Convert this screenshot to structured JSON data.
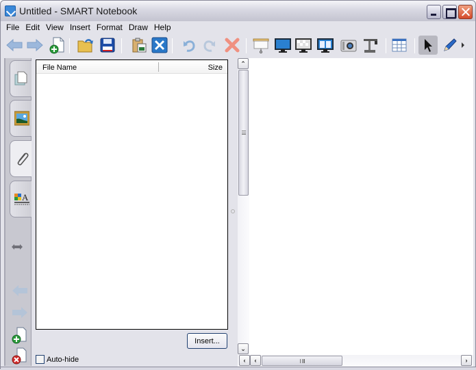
{
  "window": {
    "title": "Untitled - SMART Notebook",
    "controls": [
      "minimize",
      "maximize",
      "close"
    ]
  },
  "menu": [
    "File",
    "Edit",
    "View",
    "Insert",
    "Format",
    "Draw",
    "Help"
  ],
  "toolbar": {
    "buttons": [
      {
        "name": "back",
        "icon": "arrow-left-icon"
      },
      {
        "name": "forward",
        "icon": "arrow-right-icon"
      },
      {
        "name": "add-page",
        "icon": "add-page-icon"
      },
      {
        "name": "open",
        "icon": "open-folder-icon"
      },
      {
        "name": "save",
        "icon": "save-icon"
      },
      {
        "name": "paste",
        "icon": "paste-icon"
      },
      {
        "name": "full-screen",
        "icon": "full-screen-icon"
      },
      {
        "name": "undo",
        "icon": "undo-icon"
      },
      {
        "name": "redo",
        "icon": "redo-icon"
      },
      {
        "name": "delete",
        "icon": "delete-icon"
      },
      {
        "name": "screen-shade",
        "icon": "screen-shade-icon"
      },
      {
        "name": "full-screen-display",
        "icon": "monitor-fullscreen-icon"
      },
      {
        "name": "transparent-background",
        "icon": "monitor-transparent-icon"
      },
      {
        "name": "dual-page",
        "icon": "monitor-dual-page-icon"
      },
      {
        "name": "screen-capture",
        "icon": "camera-icon"
      },
      {
        "name": "document-camera",
        "icon": "document-camera-icon"
      },
      {
        "name": "table",
        "icon": "table-icon"
      },
      {
        "name": "select",
        "icon": "pointer-icon",
        "active": true
      },
      {
        "name": "pen",
        "icon": "pen-icon"
      },
      {
        "name": "more",
        "icon": "chevron-right-icon"
      }
    ]
  },
  "side_tabs": [
    {
      "name": "page-sorter",
      "icon": "page-sorter-icon",
      "selected": false
    },
    {
      "name": "gallery",
      "icon": "gallery-icon",
      "selected": false
    },
    {
      "name": "attachments",
      "icon": "paperclip-icon",
      "selected": true
    },
    {
      "name": "properties",
      "icon": "properties-icon",
      "selected": false
    }
  ],
  "side_controls": [
    "move-sidebar",
    "previous-page",
    "next-page",
    "add-page",
    "delete-page"
  ],
  "attachments": {
    "columns": [
      "File Name",
      "Size"
    ],
    "rows": [],
    "insert_label": "Insert...",
    "autohide_label": "Auto-hide",
    "autohide_checked": false
  }
}
